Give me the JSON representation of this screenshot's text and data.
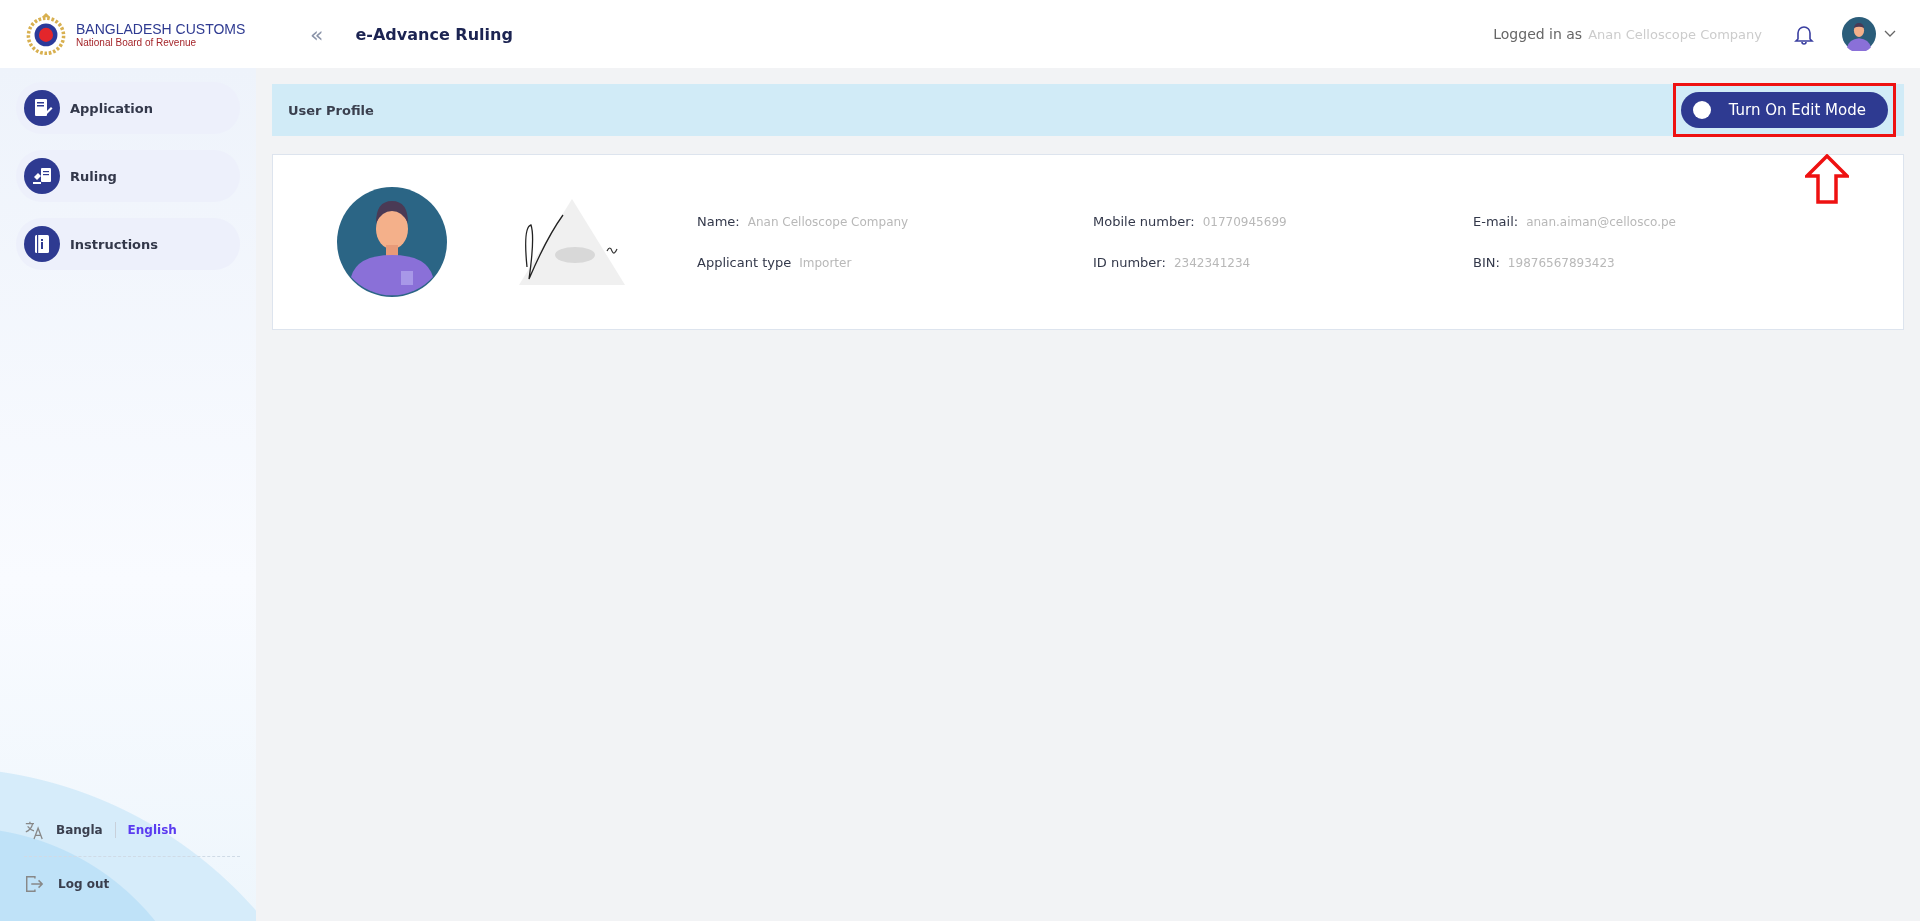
{
  "header": {
    "brand": {
      "title": "BANGLADESH CUSTOMS",
      "subtitle": "National Board of Revenue"
    },
    "collapse": "«",
    "page_title": "e-Advance Ruling",
    "logged_in_label": "Logged in as",
    "logged_in_user": "Anan Celloscope Company"
  },
  "sidebar": {
    "items": [
      {
        "label": "Application",
        "kind": "application"
      },
      {
        "label": "Ruling",
        "kind": "ruling"
      },
      {
        "label": "Instructions",
        "kind": "instructions"
      }
    ],
    "languages": [
      {
        "label": "Bangla",
        "selected": false
      },
      {
        "label": "English",
        "selected": true
      }
    ],
    "logout": "Log out"
  },
  "profile_bar": {
    "title": "User Profile",
    "edit_toggle": {
      "label": "Turn On Edit Mode",
      "on": false
    }
  },
  "profile": {
    "fields": [
      {
        "label": "Name:",
        "value": "Anan Celloscope Company"
      },
      {
        "label": "Mobile number:",
        "value": "01770945699"
      },
      {
        "label": "E-mail:",
        "value": "anan.aiman@cellosco.pe"
      },
      {
        "label": "Applicant type",
        "value": "Importer"
      },
      {
        "label": "ID number:",
        "value": "2342341234"
      },
      {
        "label": "BIN:",
        "value": "19876567893423"
      }
    ]
  }
}
